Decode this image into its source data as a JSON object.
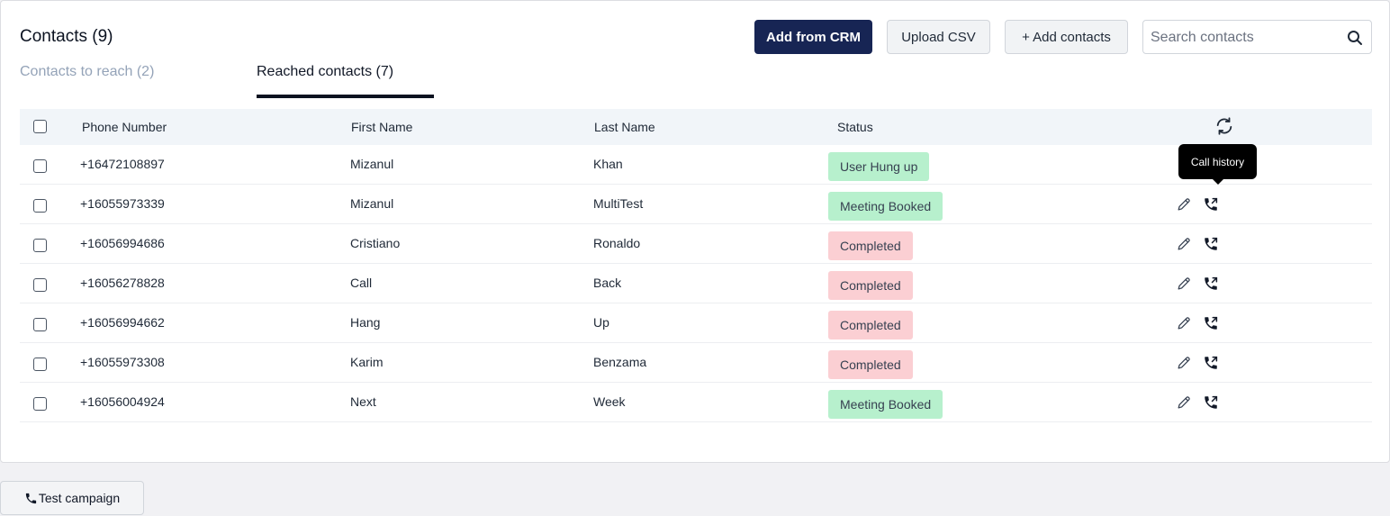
{
  "header": {
    "title": "Contacts (9)",
    "add_from_crm": "Add from CRM",
    "upload_csv": "Upload CSV",
    "add_contacts": "+ Add contacts",
    "search_placeholder": "Search contacts"
  },
  "tabs": [
    {
      "label": "Contacts to reach (2)",
      "active": false
    },
    {
      "label": "Reached contacts (7)",
      "active": true
    }
  ],
  "table": {
    "columns": [
      "Phone Number",
      "First Name",
      "Last Name",
      "Status"
    ],
    "refresh_icon": "refresh-icon",
    "rows": [
      {
        "phone": "+16472108897",
        "first": "Mizanul",
        "last": "Khan",
        "status": "User Hung up",
        "status_color": "green"
      },
      {
        "phone": "+16055973339",
        "first": "Mizanul",
        "last": "MultiTest",
        "status": "Meeting Booked",
        "status_color": "green"
      },
      {
        "phone": "+16056994686",
        "first": "Cristiano",
        "last": "Ronaldo",
        "status": "Completed",
        "status_color": "red"
      },
      {
        "phone": "+16056278828",
        "first": "Call",
        "last": "Back",
        "status": "Completed",
        "status_color": "red"
      },
      {
        "phone": "+16056994662",
        "first": "Hang",
        "last": "Up",
        "status": "Completed",
        "status_color": "red"
      },
      {
        "phone": "+16055973308",
        "first": "Karim",
        "last": "Benzama",
        "status": "Completed",
        "status_color": "red"
      },
      {
        "phone": "+16056004924",
        "first": "Next",
        "last": "Week",
        "status": "Meeting Booked",
        "status_color": "green"
      }
    ]
  },
  "tooltip": {
    "text": "Call history"
  },
  "footer": {
    "test_campaign": "Test campaign"
  },
  "colors": {
    "primary_button": "#172554",
    "badge_green": "#b7f0cd",
    "badge_red": "#fbcfd3"
  }
}
